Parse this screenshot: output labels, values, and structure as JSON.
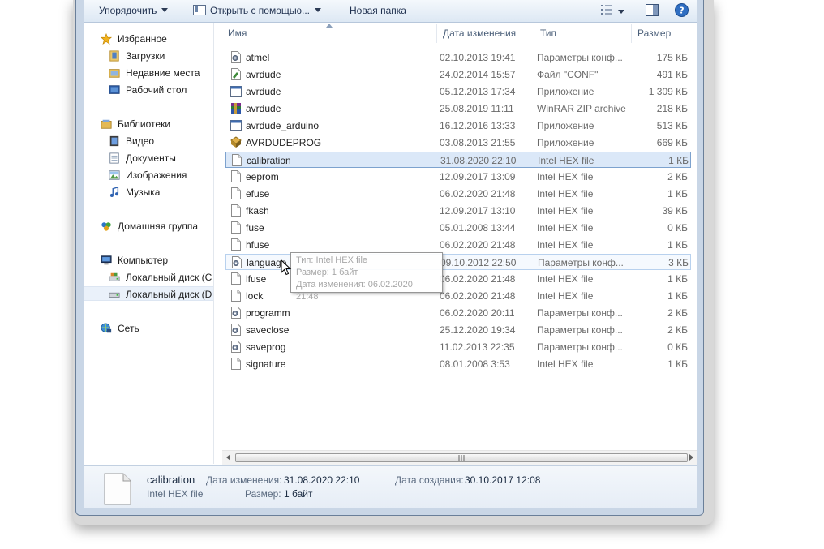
{
  "toolbar": {
    "organize": "Упорядочить",
    "open_with": "Открыть с помощью...",
    "new_folder": "Новая папка"
  },
  "nav": {
    "favorites": "Избранное",
    "downloads": "Загрузки",
    "recent": "Недавние места",
    "desktop": "Рабочий стол",
    "libraries": "Библиотеки",
    "video": "Видео",
    "documents": "Документы",
    "images": "Изображения",
    "music": "Музыка",
    "homegroup": "Домашняя группа",
    "computer": "Компьютер",
    "disk_c": "Локальный диск (C",
    "disk_d": "Локальный диск (D",
    "network": "Сеть"
  },
  "columns": {
    "name": "Имя",
    "date": "Дата изменения",
    "type": "Тип",
    "size": "Размер"
  },
  "files": [
    {
      "name": "atmel",
      "date": "02.10.2013 19:41",
      "type": "Параметры конф...",
      "size": "175 КБ",
      "icon": "config-file-icon"
    },
    {
      "name": "avrdude",
      "date": "24.02.2014 15:57",
      "type": "Файл \"CONF\"",
      "size": "491 КБ",
      "icon": "conf-file-icon"
    },
    {
      "name": "avrdude",
      "date": "05.12.2013 17:34",
      "type": "Приложение",
      "size": "1 309 КБ",
      "icon": "application-icon"
    },
    {
      "name": "avrdude",
      "date": "25.08.2019 11:11",
      "type": "WinRAR ZIP archive",
      "size": "218 КБ",
      "icon": "winrar-archive-icon"
    },
    {
      "name": "avrdude_arduino",
      "date": "16.12.2016 13:33",
      "type": "Приложение",
      "size": "513 КБ",
      "icon": "application-icon"
    },
    {
      "name": "AVRDUDEPROG",
      "date": "03.08.2013 21:55",
      "type": "Приложение",
      "size": "669 КБ",
      "icon": "program-icon"
    },
    {
      "name": "calibration",
      "date": "31.08.2020 22:10",
      "type": "Intel HEX file",
      "size": "1 КБ",
      "icon": "file-icon"
    },
    {
      "name": "eeprom",
      "date": "12.09.2017 13:09",
      "type": "Intel HEX file",
      "size": "2 КБ",
      "icon": "file-icon"
    },
    {
      "name": "efuse",
      "date": "06.02.2020 21:48",
      "type": "Intel HEX file",
      "size": "1 КБ",
      "icon": "file-icon"
    },
    {
      "name": "fkash",
      "date": "12.09.2017 13:10",
      "type": "Intel HEX file",
      "size": "39 КБ",
      "icon": "file-icon"
    },
    {
      "name": "fuse",
      "date": "05.01.2008 13:44",
      "type": "Intel HEX file",
      "size": "0 КБ",
      "icon": "file-icon"
    },
    {
      "name": "hfuse",
      "date": "06.02.2020 21:48",
      "type": "Intel HEX file",
      "size": "1 КБ",
      "icon": "file-icon"
    },
    {
      "name": "language",
      "date": "09.10.2012 22:50",
      "type": "Параметры конф...",
      "size": "3 КБ",
      "icon": "config-file-icon"
    },
    {
      "name": "lfuse",
      "date": "06.02.2020 21:48",
      "type": "Intel HEX file",
      "size": "1 КБ",
      "icon": "file-icon"
    },
    {
      "name": "lock",
      "date": "06.02.2020 21:48",
      "type": "Intel HEX file",
      "size": "1 КБ",
      "icon": "file-icon"
    },
    {
      "name": "programm",
      "date": "06.02.2020 20:11",
      "type": "Параметры конф...",
      "size": "2 КБ",
      "icon": "config-file-icon"
    },
    {
      "name": "saveclose",
      "date": "25.12.2020 19:34",
      "type": "Параметры конф...",
      "size": "2 КБ",
      "icon": "config-file-icon"
    },
    {
      "name": "saveprog",
      "date": "11.02.2013 22:35",
      "type": "Параметры конф...",
      "size": "0 КБ",
      "icon": "config-file-icon"
    },
    {
      "name": "signature",
      "date": "08.01.2008 3:53",
      "type": "Intel HEX file",
      "size": "1 КБ",
      "icon": "file-icon"
    }
  ],
  "selected_index": 6,
  "hover_index": 12,
  "tooltip": {
    "type": "Тип: Intel HEX file",
    "size": "Размер: 1 байт",
    "date": "Дата изменения: 06.02.2020 21:48"
  },
  "details": {
    "name": "calibration",
    "type": "Intel HEX file",
    "modified_label": "Дата изменения:",
    "modified_value": "31.08.2020 22:10",
    "size_label": "Размер:",
    "size_value": "1 байт",
    "created_label": "Дата создания:",
    "created_value": "30.10.2017 12:08"
  },
  "colors": {
    "selection_bg": "#dbe8f8",
    "selection_border": "#7da2ce",
    "toolbar_text": "#1e2f4e"
  }
}
